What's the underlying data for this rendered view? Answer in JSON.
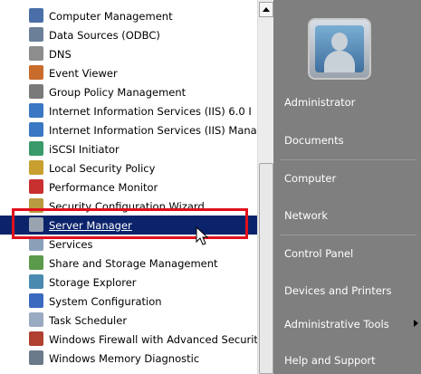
{
  "programs": [
    {
      "label": "Computer Management",
      "icon": "computer-management-icon",
      "color": "#4a6fa8"
    },
    {
      "label": "Data Sources (ODBC)",
      "icon": "data-sources-icon",
      "color": "#6b7f99"
    },
    {
      "label": "DNS",
      "icon": "dns-icon",
      "color": "#8d8d8d"
    },
    {
      "label": "Event Viewer",
      "icon": "event-viewer-icon",
      "color": "#c96b2a"
    },
    {
      "label": "Group Policy Management",
      "icon": "group-policy-icon",
      "color": "#7a7a7a"
    },
    {
      "label": "Internet Information Services (IIS) 6.0 I",
      "icon": "iis6-icon",
      "color": "#3a77c4"
    },
    {
      "label": "Internet Information Services (IIS) Mana",
      "icon": "iis-manager-icon",
      "color": "#3a77c4"
    },
    {
      "label": "iSCSI Initiator",
      "icon": "iscsi-icon",
      "color": "#3a9a6a"
    },
    {
      "label": "Local Security Policy",
      "icon": "security-policy-icon",
      "color": "#c8a030"
    },
    {
      "label": "Performance Monitor",
      "icon": "performance-monitor-icon",
      "color": "#c83030"
    },
    {
      "label": "Security Configuration Wizard",
      "icon": "security-wizard-icon",
      "color": "#b89a40"
    },
    {
      "label": "Server Manager",
      "icon": "server-manager-icon",
      "color": "#9aa4b0"
    },
    {
      "label": "Services",
      "icon": "services-icon",
      "color": "#8aa0b8"
    },
    {
      "label": "Share and Storage Management",
      "icon": "share-storage-icon",
      "color": "#5a9a4a"
    },
    {
      "label": "Storage Explorer",
      "icon": "storage-explorer-icon",
      "color": "#4a8ab0"
    },
    {
      "label": "System Configuration",
      "icon": "system-configuration-icon",
      "color": "#3a6ac0"
    },
    {
      "label": "Task Scheduler",
      "icon": "task-scheduler-icon",
      "color": "#9aaac0"
    },
    {
      "label": "Windows Firewall with Advanced Securit",
      "icon": "firewall-icon",
      "color": "#b04030"
    },
    {
      "label": "Windows Memory Diagnostic",
      "icon": "memory-diagnostic-icon",
      "color": "#6a7a8a"
    }
  ],
  "selected_index": 11,
  "right_menu": {
    "administrator": "Administrator",
    "documents": "Documents",
    "computer": "Computer",
    "network": "Network",
    "control_panel": "Control Panel",
    "devices_printers": "Devices and Printers",
    "administrative_tools": "Administrative Tools",
    "help_support": "Help and Support"
  },
  "colors": {
    "selection": "#0b236b",
    "highlight_box": "#e2101c",
    "right_pane": "#7f7f7f"
  }
}
